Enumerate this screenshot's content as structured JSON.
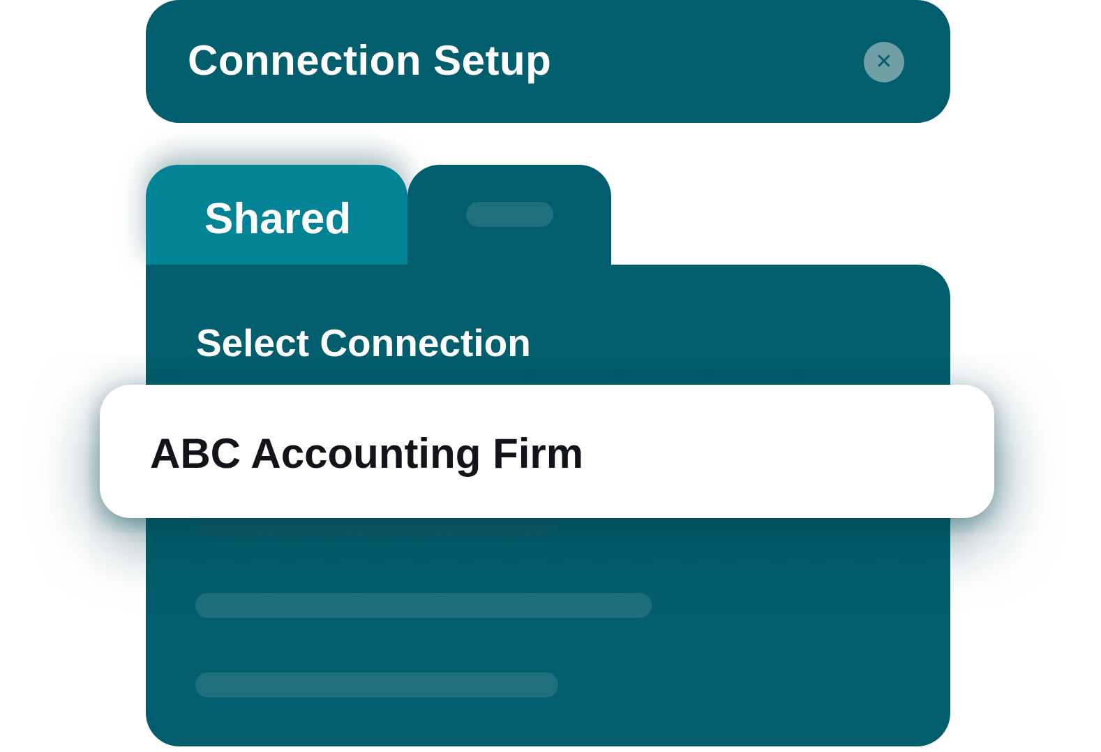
{
  "header": {
    "title": "Connection Setup",
    "close_glyph": "✕",
    "close_icon": "close-icon"
  },
  "tabs": [
    {
      "label": "Shared",
      "active": true
    },
    {
      "label": "",
      "active": false
    }
  ],
  "panel": {
    "label": "Select Connection",
    "selected_option": "ABC Accounting Firm"
  },
  "colors": {
    "panel_bg": "#025e6c",
    "active_tab": "#038396",
    "placeholder": "#1f6f7c",
    "row_bg": "#ffffff",
    "row_text": "#111418"
  }
}
